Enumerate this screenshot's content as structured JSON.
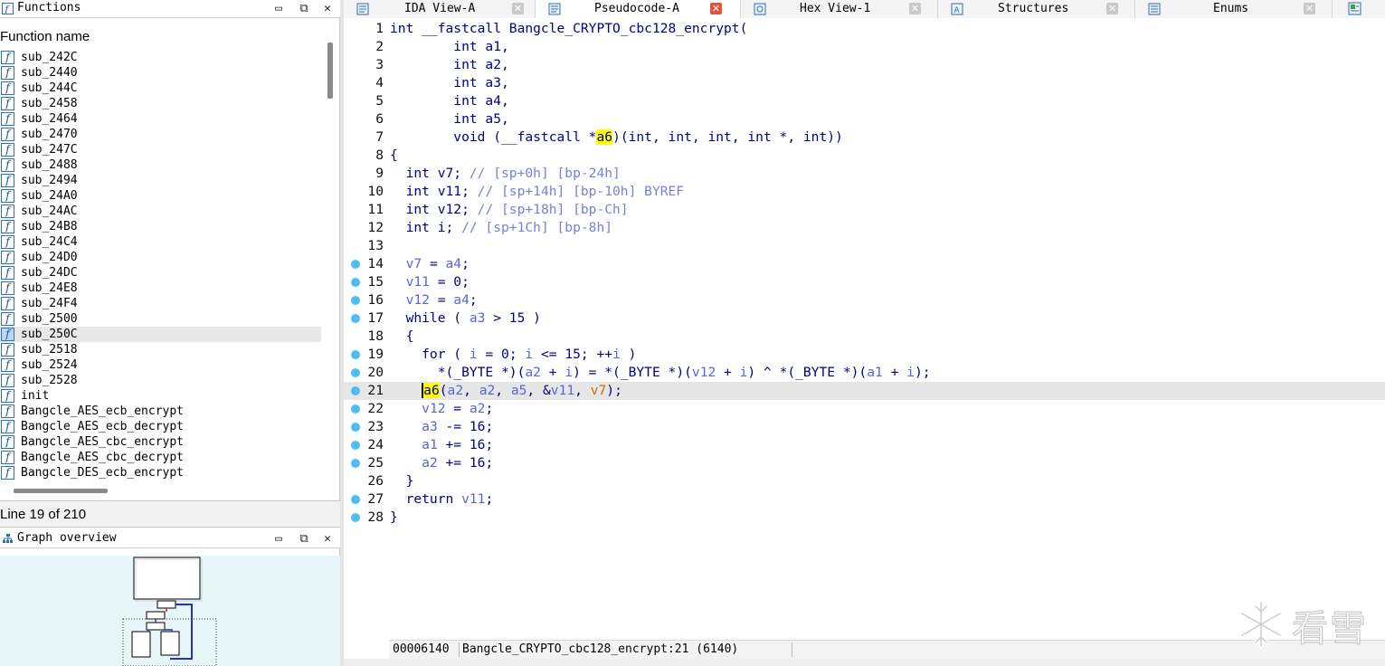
{
  "functions_panel": {
    "title": "Functions",
    "column_header": "Function name",
    "items": [
      {
        "name": "sub_242C"
      },
      {
        "name": "sub_2440"
      },
      {
        "name": "sub_244C"
      },
      {
        "name": "sub_2458"
      },
      {
        "name": "sub_2464"
      },
      {
        "name": "sub_2470"
      },
      {
        "name": "sub_247C"
      },
      {
        "name": "sub_2488"
      },
      {
        "name": "sub_2494"
      },
      {
        "name": "sub_24A0"
      },
      {
        "name": "sub_24AC"
      },
      {
        "name": "sub_24B8"
      },
      {
        "name": "sub_24C4"
      },
      {
        "name": "sub_24D0"
      },
      {
        "name": "sub_24DC"
      },
      {
        "name": "sub_24E8"
      },
      {
        "name": "sub_24F4"
      },
      {
        "name": "sub_2500"
      },
      {
        "name": "sub_250C",
        "selected": true
      },
      {
        "name": "sub_2518"
      },
      {
        "name": "sub_2524"
      },
      {
        "name": "sub_2528"
      },
      {
        "name": "init"
      },
      {
        "name": "Bangcle_AES_ecb_encrypt"
      },
      {
        "name": "Bangcle_AES_ecb_decrypt"
      },
      {
        "name": "Bangcle_AES_cbc_encrypt"
      },
      {
        "name": "Bangcle_AES_cbc_decrypt"
      },
      {
        "name": "Bangcle_DES_ecb_encrypt"
      }
    ],
    "item_icon_glyph": "f",
    "status": "Line 19 of 210"
  },
  "graph_panel": {
    "title": "Graph overview"
  },
  "window_buttons": {
    "minimize": "▭",
    "float": "⧉",
    "close": "✕"
  },
  "tabs": [
    {
      "label": "IDA View-A",
      "icon": "ida-view-icon",
      "active": false
    },
    {
      "label": "Pseudocode-A",
      "icon": "pseudocode-icon",
      "active": true
    },
    {
      "label": "Hex View-1",
      "icon": "hex-view-icon",
      "active": false
    },
    {
      "label": "Structures",
      "icon": "structures-icon",
      "active": false
    },
    {
      "label": "Enums",
      "icon": "enums-icon",
      "active": false
    }
  ],
  "tab_close_glyph": "✕",
  "code": {
    "current_line": 21,
    "lines": [
      {
        "n": "1",
        "bp": false,
        "html": "int __fastcall Bangcle_CRYPTO_cbc128_encrypt("
      },
      {
        "n": "2",
        "bp": false,
        "html": "        int a1,"
      },
      {
        "n": "3",
        "bp": false,
        "html": "        int a2,"
      },
      {
        "n": "4",
        "bp": false,
        "html": "        int a3,"
      },
      {
        "n": "5",
        "bp": false,
        "html": "        int a4,"
      },
      {
        "n": "6",
        "bp": false,
        "html": "        int a5,"
      },
      {
        "n": "7",
        "bp": false,
        "html": "        void (__fastcall *<span class='hl'>a6</span>)(int, int, int, int *, int))"
      },
      {
        "n": "8",
        "bp": false,
        "html": "{"
      },
      {
        "n": "9",
        "bp": false,
        "html": "  int v7; <span class='cmt'>// [sp+0h] [bp-24h]</span>"
      },
      {
        "n": "10",
        "bp": false,
        "html": "  int v11; <span class='cmt'>// [sp+14h] [bp-10h] BYREF</span>"
      },
      {
        "n": "11",
        "bp": false,
        "html": "  int v12; <span class='cmt'>// [sp+18h] [bp-Ch]</span>"
      },
      {
        "n": "12",
        "bp": false,
        "html": "  int i; <span class='cmt'>// [sp+1Ch] [bp-8h]</span>"
      },
      {
        "n": "13",
        "bp": false,
        "html": ""
      },
      {
        "n": "14",
        "bp": true,
        "html": "  <span class='var'>v7</span> = <span class='var'>a4</span>;"
      },
      {
        "n": "15",
        "bp": true,
        "html": "  <span class='var'>v11</span> = 0;"
      },
      {
        "n": "16",
        "bp": true,
        "html": "  <span class='var'>v12</span> = <span class='var'>a4</span>;"
      },
      {
        "n": "17",
        "bp": true,
        "html": "  while ( <span class='var'>a3</span> &gt; 15 )"
      },
      {
        "n": "18",
        "bp": false,
        "html": "  {"
      },
      {
        "n": "19",
        "bp": true,
        "html": "    for ( <span class='var'>i</span> = 0; <span class='var'>i</span> &lt;= 15; ++<span class='var'>i</span> )"
      },
      {
        "n": "20",
        "bp": true,
        "html": "      *(_BYTE *)(<span class='var'>a2</span> + <span class='var'>i</span>) = *(_BYTE *)(<span class='var'>v12</span> + <span class='var'>i</span>) ^ *(_BYTE *)(<span class='var'>a1</span> + <span class='var'>i</span>);"
      },
      {
        "n": "21",
        "bp": true,
        "html": "    <span class='hl'><span class='caret'></span>a6</span>(<span class='var'>a2</span>, <span class='var'>a2</span>, <span class='var'>a5</span>, &amp;<span class='var'>v11</span>, <span class='orange'>v7</span>);"
      },
      {
        "n": "22",
        "bp": true,
        "html": "    <span class='var'>v12</span> = <span class='var'>a2</span>;"
      },
      {
        "n": "23",
        "bp": true,
        "html": "    <span class='var'>a3</span> -= 16;"
      },
      {
        "n": "24",
        "bp": true,
        "html": "    <span class='var'>a1</span> += 16;"
      },
      {
        "n": "25",
        "bp": true,
        "html": "    <span class='var'>a2</span> += 16;"
      },
      {
        "n": "26",
        "bp": false,
        "html": "  }"
      },
      {
        "n": "27",
        "bp": true,
        "html": "  return <span class='var'>v11</span>;"
      },
      {
        "n": "28",
        "bp": true,
        "html": "}"
      }
    ]
  },
  "address_bar": {
    "address": "00006140",
    "location": "Bangcle_CRYPTO_cbc128_encrypt:21 (6140)"
  },
  "watermark": {
    "text": "看雪",
    "icon": "snowflake-icon"
  },
  "colors": {
    "breakpoint": "#4fbdf0",
    "highlight": "#ffff00",
    "active_tab_close": "#e0533d",
    "keyword": "#000080",
    "variable": "#5a64d8",
    "comment": "#7a7fd8"
  }
}
